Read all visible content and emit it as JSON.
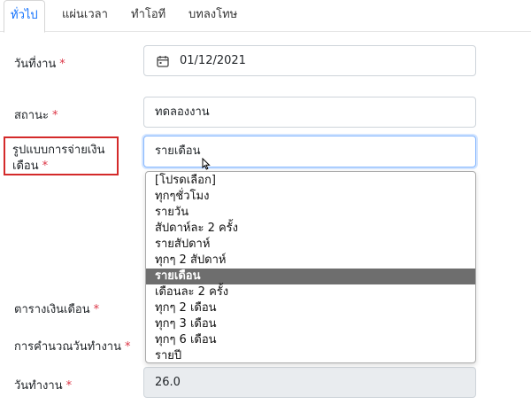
{
  "tabs": [
    {
      "label": "ทั่วไป",
      "active": true
    },
    {
      "label": "แผ่นเวลา",
      "active": false
    },
    {
      "label": "ทำโอที",
      "active": false
    },
    {
      "label": "บทลงโทษ",
      "active": false
    }
  ],
  "form": {
    "required_mark": "*",
    "work_date": {
      "label": "วันที่งาน",
      "value": "01/12/2021"
    },
    "status": {
      "label": "สถานะ",
      "value": "ทดลองงาน"
    },
    "pay_type": {
      "label_line1": "รูปแบบการจ่ายเงิน",
      "label_line2": "เดือน",
      "value": "รายเดือน"
    },
    "salary_schedule": {
      "label": "ตารางเงินเดือน"
    },
    "workday_calc": {
      "label": "การคำนวณวันทำงาน"
    },
    "workdays": {
      "label": "วันทำงาน",
      "value": "26.0"
    }
  },
  "dropdown": {
    "options": [
      "[โปรดเลือก]",
      "ทุกๆชั่วโมง",
      "รายวัน",
      "สัปดาห์ละ 2 ครั้ง",
      "รายสัปดาห์",
      "ทุกๆ 2 สัปดาห์",
      "รายเดือน",
      "เดือนละ 2 ครั้ง",
      "ทุกๆ 2 เดือน",
      "ทุกๆ 3 เดือน",
      "ทุกๆ 6 เดือน",
      "รายปี"
    ],
    "selected_index": 6
  },
  "icons": {
    "date_field": "calendar-icon",
    "pointer": "mouse-cursor-icon"
  },
  "colors": {
    "required": "#dc3545",
    "highlight_box": "#d42a2a",
    "selected_option_bg": "#6e6e6e",
    "focus_border": "#86b7fe"
  }
}
